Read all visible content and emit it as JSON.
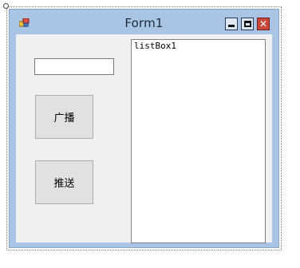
{
  "window": {
    "title": "Form1",
    "minimize_icon": "minimize-icon",
    "maximize_icon": "maximize-icon",
    "close_icon": "close-icon",
    "close_symbol": "✕",
    "accent_color": "#a9c4e4",
    "close_color": "#c9483b"
  },
  "form": {
    "text_input": {
      "value": "",
      "placeholder": ""
    },
    "broadcast_button": "广播",
    "push_button": "推送",
    "listbox": {
      "name": "listBox1",
      "items": []
    }
  }
}
